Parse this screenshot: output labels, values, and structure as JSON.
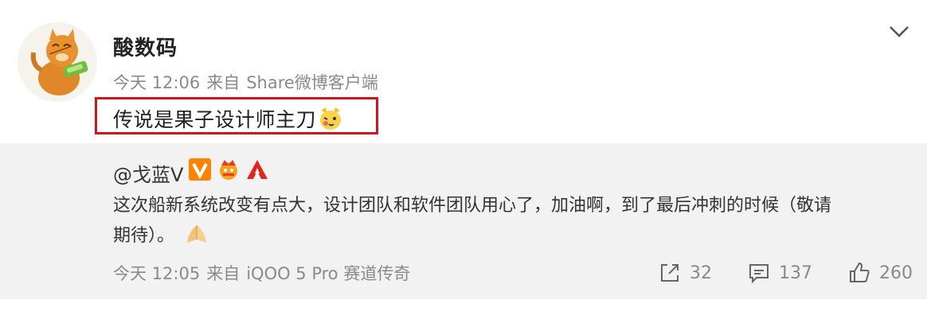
{
  "post": {
    "username": "酸数码",
    "time": "今天 12:06",
    "source_prefix": "来自",
    "source": "Share微博客户端",
    "text": "传说是果子设计师主刀"
  },
  "repost": {
    "user": "@戈蓝V",
    "line1": "这次船新系统改变有点大，设计团队和软件团队用心了，加油啊，到了最后冲刺的时候（敬请",
    "line2": "期待）。",
    "time": "今天 12:05",
    "source_prefix": "来自",
    "source": "iQOO 5 Pro 赛道传奇",
    "forward_count": "32",
    "comment_count": "137",
    "like_count": "260"
  },
  "colors": {
    "highlight_border": "#d0161d",
    "repost_bg": "#f2f2f2",
    "meta_text": "#8a8a8a",
    "vip_badge": "#ff8200"
  },
  "icons": [
    "avatar-cat-icon",
    "chevron-down-icon",
    "wink-emoji-icon",
    "vip-badge-icon",
    "crown-badge-icon",
    "brand-badge-icon",
    "pray-emoji-icon",
    "forward-icon",
    "comment-icon",
    "like-icon"
  ]
}
